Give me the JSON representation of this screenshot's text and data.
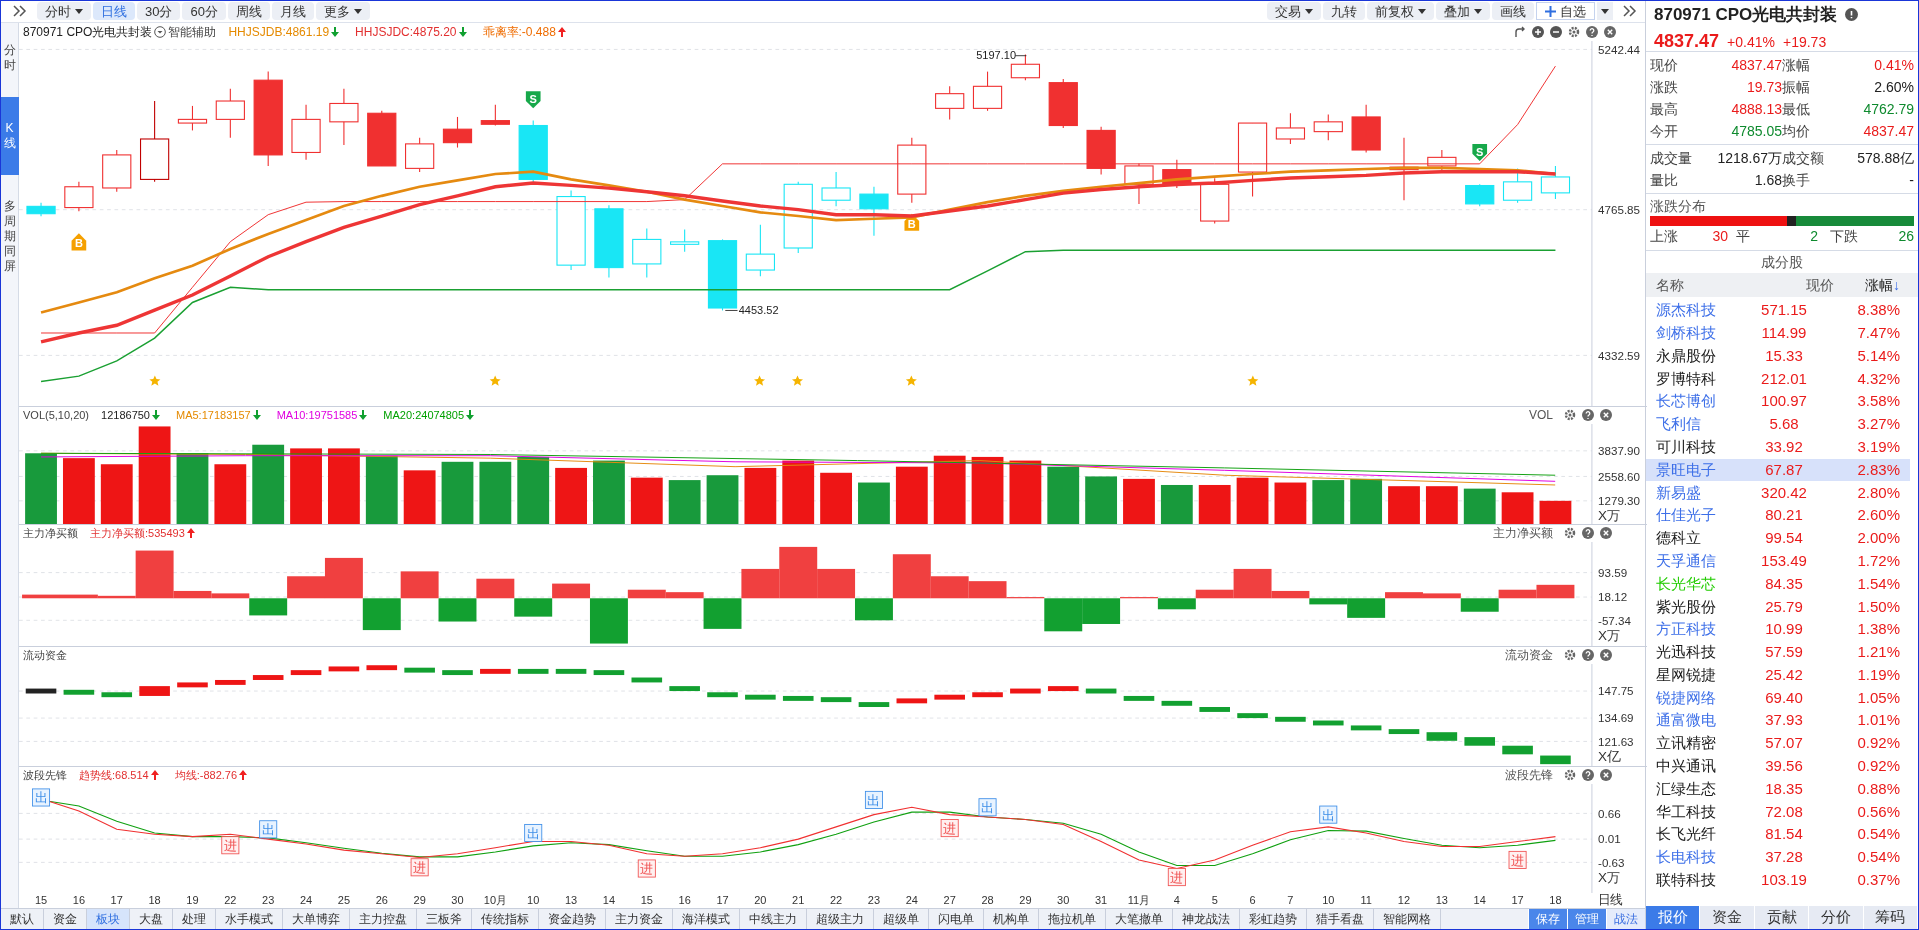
{
  "toolbar": {
    "left": [
      {
        "label": "分时",
        "dropdown": true,
        "selected": false
      },
      {
        "label": "日线",
        "dropdown": false,
        "selected": true
      },
      {
        "label": "30分",
        "dropdown": false,
        "selected": false
      },
      {
        "label": "60分",
        "dropdown": false,
        "selected": false
      },
      {
        "label": "周线",
        "dropdown": false,
        "selected": false
      },
      {
        "label": "月线",
        "dropdown": false,
        "selected": false
      },
      {
        "label": "更多",
        "dropdown": true,
        "selected": false
      }
    ],
    "right": [
      {
        "label": "交易",
        "dropdown": true
      },
      {
        "label": "九转",
        "dropdown": false
      },
      {
        "label": "前复权",
        "dropdown": true
      },
      {
        "label": "叠加",
        "dropdown": true
      },
      {
        "label": "画线",
        "dropdown": false
      }
    ],
    "watchlist_button": "自选"
  },
  "side_tabs": [
    {
      "label": "分时",
      "selected": false
    },
    {
      "label": "K线",
      "selected": true
    },
    {
      "label": "多周期同屏",
      "selected": false
    }
  ],
  "main_chart": {
    "title": "870971 CPO光电共封装",
    "assist": "智能辅助",
    "indicators": [
      {
        "text": "HHJSJDB:4861.19",
        "color": "#e58a00",
        "rising": false
      },
      {
        "text": "HHJSJDC:4875.20",
        "color": "#e23030",
        "rising": false
      },
      {
        "text": "乖离率:-0.488",
        "color": "#ef6c00",
        "rising": true
      }
    ],
    "high_label": "5197.10",
    "low_label": "4453.52",
    "signals": [
      {
        "kind": "buy",
        "label": "B"
      },
      {
        "kind": "sell",
        "label": "S"
      },
      {
        "kind": "buy",
        "label": "B"
      },
      {
        "kind": "sell",
        "label": "S"
      }
    ],
    "chart_data": {
      "type": "line",
      "grid": true,
      "ylim": [
        4182.1,
        5267.5
      ],
      "yticks": [
        {
          "value": 5242.44,
          "label": "5242.44"
        },
        {
          "value": 4765.85,
          "label": "4765.85"
        },
        {
          "value": 4332.59,
          "label": "4332.59"
        }
      ],
      "series": [
        {
          "color": "#e58a10",
          "values": [
            4460,
            4490,
            4520,
            4562,
            4599,
            4649,
            4694,
            4735,
            4777,
            4807,
            4834,
            4853,
            4872,
            4879,
            4856,
            4838,
            4819,
            4796,
            4777,
            4758,
            4747,
            4735,
            4739,
            4743,
            4766,
            4788,
            4807,
            4822,
            4834,
            4845,
            4856,
            4864,
            4872,
            4879,
            4883,
            4887,
            4890,
            4890,
            4887,
            4883,
            4872
          ]
        },
        {
          "color": "#ee3535",
          "values": [
            4373,
            4399,
            4422,
            4467,
            4512,
            4569,
            4626,
            4671,
            4713,
            4747,
            4781,
            4807,
            4834,
            4845,
            4838,
            4830,
            4819,
            4807,
            4792,
            4777,
            4766,
            4751,
            4751,
            4747,
            4762,
            4777,
            4796,
            4815,
            4826,
            4834,
            4841,
            4845,
            4853,
            4860,
            4864,
            4868,
            4875,
            4879,
            4879,
            4879,
            4872
          ]
        },
        {
          "color": "#f03030",
          "values": [
            4399,
            4399,
            4399,
            4399,
            4535,
            4671,
            4751,
            4788,
            4790,
            4790,
            4790,
            4790,
            4790,
            4790,
            4790,
            4790,
            4790,
            4796,
            4902,
            4902,
            4902,
            4902,
            4902,
            4902,
            4902,
            4902,
            4902,
            4902,
            4902,
            4902,
            4902,
            4902,
            4902,
            4902,
            4902,
            4902,
            4902,
            4902,
            4902,
            5019,
            5193
          ]
        },
        {
          "color": "#1aa032",
          "values": [
            4255,
            4271,
            4316,
            4384,
            4490,
            4535,
            4528,
            4528,
            4528,
            4528,
            4528,
            4528,
            4528,
            4528,
            4528,
            4528,
            4528,
            4528,
            4528,
            4528,
            4528,
            4528,
            4528,
            4528,
            4528,
            4584,
            4641,
            4645,
            4645,
            4645,
            4645,
            4645,
            4645,
            4645,
            4645,
            4645,
            4645,
            4645,
            4645,
            4645,
            4645
          ]
        }
      ]
    }
  },
  "volume_panel": {
    "name": "VOL(5,10,20)",
    "title": "VOL",
    "items": [
      {
        "text": "12186750",
        "color": "#222222",
        "rising": false
      },
      {
        "text": "MA5:17183157",
        "color": "#e58a00",
        "rising": false
      },
      {
        "text": "MA10:19751585",
        "color": "#e000e0",
        "rising": false
      },
      {
        "text": "MA20:24074805",
        "color": "#00a000",
        "rising": false
      }
    ],
    "yticks": [
      "3837.90",
      "2558.60",
      "1279.30"
    ],
    "unit": "X万"
  },
  "netbuy_panel": {
    "name": "主力净买额",
    "title": "主力净买额",
    "items": [
      {
        "text": "主力净买额:535493",
        "color": "#e23030",
        "rising": true
      }
    ],
    "yticks": [
      "93.59",
      "18.12",
      "-57.34"
    ],
    "unit": "X万"
  },
  "flow_panel": {
    "name": "流动资金",
    "title": "流动资金",
    "yticks": [
      "147.75",
      "134.69",
      "121.63"
    ],
    "unit": "X亿"
  },
  "wave_panel": {
    "name": "波段先锋",
    "title": "波段先锋",
    "items": [
      {
        "text": "趋势线:68.514",
        "color": "#e23030",
        "rising": true
      },
      {
        "text": "均线:-882.76",
        "color": "#e23030",
        "rising": true
      }
    ],
    "yticks": [
      "0.66",
      "0.01",
      "-0.63"
    ],
    "unit": "X万",
    "signals": [
      {
        "kind": "out",
        "label": "出"
      },
      {
        "kind": "in",
        "label": "进"
      },
      {
        "kind": "out",
        "label": "出"
      },
      {
        "kind": "in",
        "label": "进"
      },
      {
        "kind": "out",
        "label": "出"
      },
      {
        "kind": "in",
        "label": "进"
      },
      {
        "kind": "out",
        "label": "出"
      },
      {
        "kind": "in",
        "label": "进"
      },
      {
        "kind": "out",
        "label": "出"
      },
      {
        "kind": "in",
        "label": "进"
      },
      {
        "kind": "out",
        "label": "出"
      },
      {
        "kind": "in",
        "label": "进"
      }
    ]
  },
  "dates": [
    "15",
    "16",
    "17",
    "18",
    "19",
    "22",
    "23",
    "24",
    "25",
    "26",
    "29",
    "30",
    "10月",
    "10",
    "13",
    "14",
    "15",
    "16",
    "17",
    "20",
    "21",
    "22",
    "23",
    "24",
    "27",
    "28",
    "29",
    "30",
    "31",
    "11月",
    "4",
    "5",
    "6",
    "7",
    "10",
    "11",
    "12",
    "13",
    "14",
    "17",
    "18"
  ],
  "period_label": "日线",
  "bottom_tabs": [
    {
      "label": "默认",
      "selected": false
    },
    {
      "label": "资金",
      "selected": false
    },
    {
      "label": "板块",
      "selected": true
    },
    {
      "label": "大盘",
      "selected": false
    },
    {
      "label": "处理",
      "selected": false
    },
    {
      "label": "水手模式",
      "selected": false
    },
    {
      "label": "大单博弈",
      "selected": false
    },
    {
      "label": "主力控盘",
      "selected": false
    },
    {
      "label": "三板斧",
      "selected": false
    },
    {
      "label": "传统指标",
      "selected": false
    },
    {
      "label": "资金趋势",
      "selected": false
    },
    {
      "label": "主力资金",
      "selected": false
    },
    {
      "label": "海洋模式",
      "selected": false
    },
    {
      "label": "中线主力",
      "selected": false
    },
    {
      "label": "超级主力",
      "selected": false
    },
    {
      "label": "超级单",
      "selected": false
    },
    {
      "label": "闪电单",
      "selected": false
    },
    {
      "label": "机构单",
      "selected": false
    },
    {
      "label": "拖拉机单",
      "selected": false
    },
    {
      "label": "大笔撤单",
      "selected": false
    },
    {
      "label": "神龙战法",
      "selected": false
    },
    {
      "label": "彩虹趋势",
      "selected": false
    },
    {
      "label": "猎手看盘",
      "selected": false
    },
    {
      "label": "智能网格",
      "selected": false
    }
  ],
  "bottom_actions": [
    "保存",
    "管理",
    "战法"
  ],
  "quote": {
    "title": "870971 CPO光电共封装",
    "price": "4837.47",
    "change_pct": "+0.41%",
    "change": "+19.73",
    "rows": [
      [
        {
          "label": "现价",
          "value": "4837.47",
          "color": "#ea1b1b"
        },
        {
          "label": "涨幅",
          "value": "0.41%",
          "color": "#ea1b1b"
        }
      ],
      [
        {
          "label": "涨跌",
          "value": "19.73",
          "color": "#ea1b1b"
        },
        {
          "label": "振幅",
          "value": "2.60%",
          "color": "#222222"
        }
      ],
      [
        {
          "label": "最高",
          "value": "4888.13",
          "color": "#ea1b1b"
        },
        {
          "label": "最低",
          "value": "4762.79",
          "color": "#0e8a2e"
        }
      ],
      [
        {
          "label": "今开",
          "value": "4785.05",
          "color": "#0e8a2e"
        },
        {
          "label": "均价",
          "value": "4837.47",
          "color": "#ea1b1b"
        }
      ]
    ],
    "rows2": [
      [
        {
          "label": "成交量",
          "value": "1218.67万",
          "color": "#222222"
        },
        {
          "label": "成交额",
          "value": "578.88亿",
          "color": "#222222"
        }
      ],
      [
        {
          "label": "量比",
          "value": "1.68",
          "color": "#222222"
        },
        {
          "label": "换手",
          "value": "-",
          "color": "#222222"
        }
      ]
    ]
  },
  "distribution": {
    "title": "涨跌分布",
    "up_label": "上涨",
    "up": "30",
    "flat_label": "平",
    "flat": "2",
    "down_label": "下跌",
    "down": "26"
  },
  "constituents": {
    "title": "成分股",
    "columns": [
      "名称",
      "现价",
      "涨幅"
    ],
    "sort_arrow": "↓",
    "rows": [
      {
        "name": "源杰科技",
        "price": "571.15",
        "pct": "8.38%",
        "color": "#3d6fe8",
        "selected": false
      },
      {
        "name": "剑桥科技",
        "price": "114.99",
        "pct": "7.47%",
        "color": "#3d6fe8",
        "selected": false
      },
      {
        "name": "永鼎股份",
        "price": "15.33",
        "pct": "5.14%",
        "color": "#1a1a1a",
        "selected": false
      },
      {
        "name": "罗博特科",
        "price": "212.01",
        "pct": "4.32%",
        "color": "#1a1a1a",
        "selected": false
      },
      {
        "name": "长芯博创",
        "price": "100.97",
        "pct": "3.58%",
        "color": "#3d6fe8",
        "selected": false
      },
      {
        "name": "飞利信",
        "price": "5.68",
        "pct": "3.27%",
        "color": "#3d6fe8",
        "selected": false
      },
      {
        "name": "可川科技",
        "price": "33.92",
        "pct": "3.19%",
        "color": "#1a1a1a",
        "selected": false
      },
      {
        "name": "景旺电子",
        "price": "67.87",
        "pct": "2.83%",
        "color": "#3d6fe8",
        "selected": true
      },
      {
        "name": "新易盛",
        "price": "320.42",
        "pct": "2.80%",
        "color": "#3d6fe8",
        "selected": false
      },
      {
        "name": "仕佳光子",
        "price": "80.21",
        "pct": "2.60%",
        "color": "#3d6fe8",
        "selected": false
      },
      {
        "name": "德科立",
        "price": "99.54",
        "pct": "2.00%",
        "color": "#1a1a1a",
        "selected": false
      },
      {
        "name": "天孚通信",
        "price": "153.49",
        "pct": "1.72%",
        "color": "#3d6fe8",
        "selected": false
      },
      {
        "name": "长光华芯",
        "price": "84.35",
        "pct": "1.54%",
        "color": "#22cc00",
        "selected": false
      },
      {
        "name": "紫光股份",
        "price": "25.79",
        "pct": "1.50%",
        "color": "#1a1a1a",
        "selected": false
      },
      {
        "name": "方正科技",
        "price": "10.99",
        "pct": "1.38%",
        "color": "#3d6fe8",
        "selected": false
      },
      {
        "name": "光迅科技",
        "price": "57.59",
        "pct": "1.21%",
        "color": "#1a1a1a",
        "selected": false
      },
      {
        "name": "星网锐捷",
        "price": "25.42",
        "pct": "1.19%",
        "color": "#1a1a1a",
        "selected": false
      },
      {
        "name": "锐捷网络",
        "price": "69.40",
        "pct": "1.05%",
        "color": "#3d6fe8",
        "selected": false
      },
      {
        "name": "通富微电",
        "price": "37.93",
        "pct": "1.01%",
        "color": "#3d6fe8",
        "selected": false
      },
      {
        "name": "立讯精密",
        "price": "57.07",
        "pct": "0.92%",
        "color": "#1a1a1a",
        "selected": false
      },
      {
        "name": "中兴通讯",
        "price": "39.56",
        "pct": "0.92%",
        "color": "#1a1a1a",
        "selected": false
      },
      {
        "name": "汇绿生态",
        "price": "18.35",
        "pct": "0.88%",
        "color": "#1a1a1a",
        "selected": false
      },
      {
        "name": "华工科技",
        "price": "72.08",
        "pct": "0.56%",
        "color": "#1a1a1a",
        "selected": false
      },
      {
        "name": "长飞光纤",
        "price": "81.54",
        "pct": "0.54%",
        "color": "#1a1a1a",
        "selected": false
      },
      {
        "name": "长电科技",
        "price": "37.28",
        "pct": "0.54%",
        "color": "#3d6fe8",
        "selected": false
      },
      {
        "name": "联特科技",
        "price": "103.19",
        "pct": "0.37%",
        "color": "#1a1a1a",
        "selected": false
      }
    ]
  },
  "panel_tabs": [
    {
      "label": "报价",
      "selected": true
    },
    {
      "label": "资金",
      "selected": false
    },
    {
      "label": "贡献",
      "selected": false
    },
    {
      "label": "分价",
      "selected": false
    },
    {
      "label": "筹码",
      "selected": false
    }
  ]
}
